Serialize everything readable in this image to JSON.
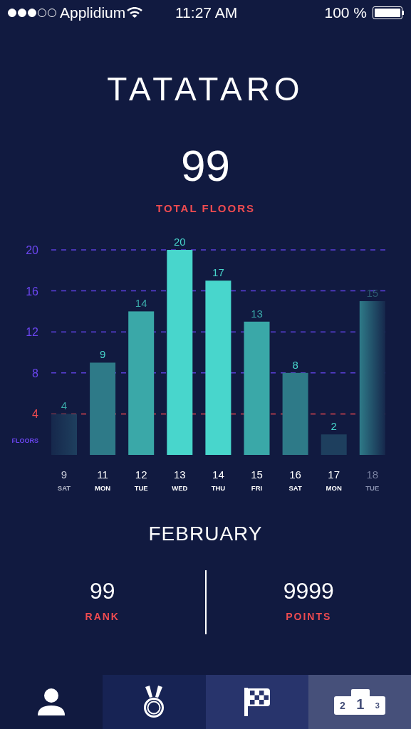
{
  "status_bar": {
    "carrier": "Applidium",
    "time": "11:27 AM",
    "battery": "100 %"
  },
  "title": "TATATARO",
  "total": {
    "value": "99",
    "label": "TOTAL FLOORS"
  },
  "chart": {
    "chart_data": {
      "type": "bar",
      "ylabel": "FLOORS",
      "categories": [
        "9",
        "11",
        "12",
        "13",
        "14",
        "15",
        "16",
        "17",
        "18"
      ],
      "values": [
        4,
        9,
        14,
        20,
        17,
        13,
        8,
        2,
        15
      ],
      "yticks": [
        4,
        8,
        12,
        16,
        20
      ],
      "ylim": [
        0,
        20
      ],
      "grid": true,
      "data_labels": true,
      "ref_lines": [
        {
          "axis": "y",
          "value": 4,
          "color": "#e0464e"
        }
      ]
    },
    "weekdays": [
      "SAT",
      "MON",
      "TUE",
      "WED",
      "THU",
      "FRI",
      "SAT",
      "MON",
      "TUE"
    ]
  },
  "month": "FEBRUARY",
  "stats": [
    {
      "value": "99",
      "label": "RANK"
    },
    {
      "value": "9999",
      "label": "POINTS"
    }
  ],
  "tabs": [
    {
      "kind": "profile",
      "color": "#111a40"
    },
    {
      "kind": "medal",
      "color": "#172354"
    },
    {
      "kind": "flag",
      "color": "#28346c"
    },
    {
      "kind": "podium",
      "color": "#46507a",
      "labels": [
        "2",
        "1",
        "3"
      ]
    }
  ]
}
